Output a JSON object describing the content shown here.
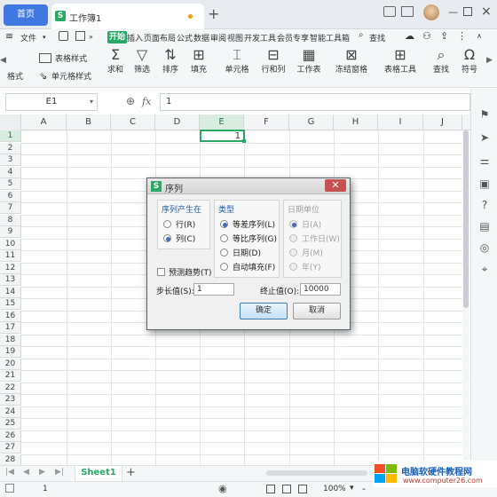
{
  "titlebar": {
    "home_tab": "首页",
    "doc_icon": "S",
    "doc_name": "工作簿1",
    "unsaved_dot_color": "#f39c12",
    "close_glyph": "×",
    "add_glyph": "+",
    "right_icons": [
      "layout-icon",
      "grid-icon",
      "avatar"
    ]
  },
  "menubar": {
    "file_label": "文件",
    "items": [
      "开始",
      "插入",
      "页面布局",
      "公式",
      "数据",
      "审阅",
      "视图",
      "开发工具",
      "会员专享",
      "智能工具箱"
    ],
    "search": "查找"
  },
  "toolbar": {
    "left_top": "表格样式",
    "left_bottom": "单元格样式",
    "left_cut": "格式",
    "buttons": [
      "求和",
      "筛选",
      "排序",
      "填充",
      "单元格",
      "行和列",
      "工作表",
      "冻结窗格",
      "表格工具",
      "查找",
      "符号"
    ]
  },
  "formula": {
    "name_box": "E1",
    "fx": "fx",
    "value": "1"
  },
  "sheet": {
    "columns": [
      "A",
      "B",
      "C",
      "D",
      "E",
      "F",
      "G",
      "H",
      "I",
      "J"
    ],
    "rows": [
      "1",
      "2",
      "3",
      "4",
      "5",
      "6",
      "7",
      "8",
      "9",
      "10",
      "11",
      "12",
      "13",
      "14",
      "15",
      "16",
      "17",
      "18",
      "19",
      "20",
      "21",
      "22",
      "23",
      "24",
      "25",
      "26",
      "27",
      "28"
    ],
    "selected_value": "1"
  },
  "sheetbar": {
    "tab": "Sheet1",
    "add": "+"
  },
  "statusbar": {
    "left_value": "1",
    "zoom": "100%",
    "minus": "-"
  },
  "dialog": {
    "icon": "S",
    "title": "序列",
    "group_series": "序列产生在",
    "opt_row": "行(R)",
    "opt_col": "列(C)",
    "group_type": "类型",
    "opt_linear": "等差序列(L)",
    "opt_growth": "等比序列(G)",
    "opt_date": "日期(D)",
    "opt_auto": "自动填充(F)",
    "group_unit": "日期单位",
    "opt_day": "日(A)",
    "opt_weekday": "工作日(W)",
    "opt_month": "月(M)",
    "opt_year": "年(Y)",
    "trend": "预测趋势(T)",
    "step_label": "步长值(S):",
    "step_value": "1",
    "stop_label": "终止值(O):",
    "stop_value": "10000",
    "ok": "确定",
    "cancel": "取消"
  },
  "watermark": {
    "title": "电脑软硬件教程网",
    "url": "www.computer26.com"
  }
}
